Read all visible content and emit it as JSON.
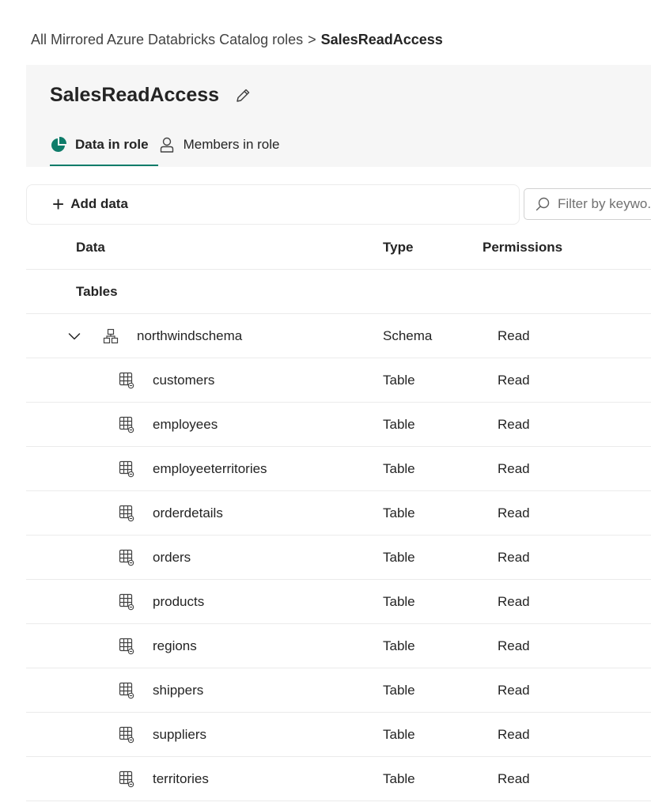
{
  "breadcrumb": {
    "parent": "All Mirrored Azure Databricks Catalog roles",
    "separator": ">",
    "current": "SalesReadAccess"
  },
  "header": {
    "title": "SalesReadAccess",
    "edit_icon": "pencil-icon",
    "tabs": [
      {
        "label": "Data in role",
        "icon": "pie-chart-icon",
        "active": true
      },
      {
        "label": "Members in role",
        "icon": "person-icon",
        "active": false
      }
    ]
  },
  "toolbar": {
    "add_data_label": "Add data",
    "filter_placeholder": "Filter by keywo..."
  },
  "table": {
    "columns": [
      "Data",
      "Type",
      "Permissions"
    ],
    "section_label": "Tables",
    "schema": {
      "name": "northwindschema",
      "type": "Schema",
      "permission": "Read",
      "expanded": true
    },
    "rows": [
      {
        "name": "customers",
        "type": "Table",
        "permission": "Read"
      },
      {
        "name": "employees",
        "type": "Table",
        "permission": "Read"
      },
      {
        "name": "employeeterritories",
        "type": "Table",
        "permission": "Read"
      },
      {
        "name": "orderdetails",
        "type": "Table",
        "permission": "Read"
      },
      {
        "name": "orders",
        "type": "Table",
        "permission": "Read"
      },
      {
        "name": "products",
        "type": "Table",
        "permission": "Read"
      },
      {
        "name": "regions",
        "type": "Table",
        "permission": "Read"
      },
      {
        "name": "shippers",
        "type": "Table",
        "permission": "Read"
      },
      {
        "name": "suppliers",
        "type": "Table",
        "permission": "Read"
      },
      {
        "name": "territories",
        "type": "Table",
        "permission": "Read"
      }
    ]
  },
  "colors": {
    "accent": "#0f7c6a",
    "header_bg": "#f6f6f6"
  }
}
